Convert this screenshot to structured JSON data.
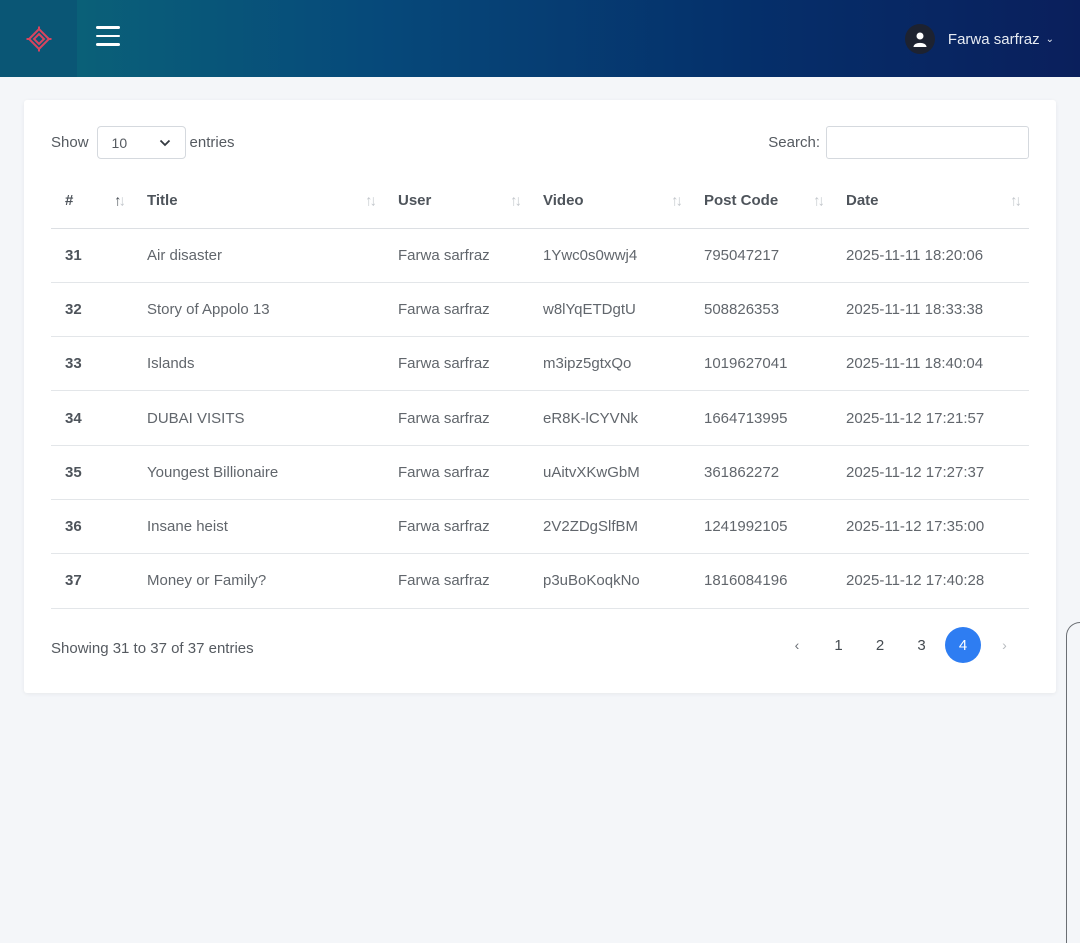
{
  "header": {
    "logo_icon": "diamond-gear-logo",
    "menu_icon": "hamburger-icon",
    "user_icon": "user-icon",
    "user_name": "Farwa sarfraz",
    "brand_colors": {
      "gradient_start": "#0b6678",
      "gradient_end": "#0a1f5c",
      "logo": "#d9445f"
    }
  },
  "controls": {
    "show_label": "Show",
    "entries_label": "entries",
    "page_length": "10",
    "search_label": "Search:",
    "search_value": ""
  },
  "table": {
    "columns": [
      "#",
      "Title",
      "User",
      "Video",
      "Post Code",
      "Date"
    ],
    "rows": [
      {
        "num": "31",
        "title": "Air disaster",
        "user": "Farwa sarfraz",
        "video": "1Ywc0s0wwj4",
        "post_code": "795047217",
        "date": "2025-11-11 18:20:06"
      },
      {
        "num": "32",
        "title": "Story of Appolo 13",
        "user": "Farwa sarfraz",
        "video": "w8lYqETDgtU",
        "post_code": "508826353",
        "date": "2025-11-11 18:33:38"
      },
      {
        "num": "33",
        "title": "Islands",
        "user": "Farwa sarfraz",
        "video": "m3ipz5gtxQo",
        "post_code": "1019627041",
        "date": "2025-11-11 18:40:04"
      },
      {
        "num": "34",
        "title": "DUBAI VISITS",
        "user": "Farwa sarfraz",
        "video": "eR8K-lCYVNk",
        "post_code": "1664713995",
        "date": "2025-11-12 17:21:57"
      },
      {
        "num": "35",
        "title": "Youngest Billionaire",
        "user": "Farwa sarfraz",
        "video": "uAitvXKwGbM",
        "post_code": "361862272",
        "date": "2025-11-12 17:27:37"
      },
      {
        "num": "36",
        "title": "Insane heist",
        "user": "Farwa sarfraz",
        "video": "2V2ZDgSlfBM",
        "post_code": "1241992105",
        "date": "2025-11-12 17:35:00"
      },
      {
        "num": "37",
        "title": "Money or Family?",
        "user": "Farwa sarfraz",
        "video": "p3uBoKoqkNo",
        "post_code": "1816084196",
        "date": "2025-11-12 17:40:28"
      }
    ]
  },
  "footer": {
    "info": "Showing 31 to 37 of 37 entries",
    "prev": "‹",
    "next": "›",
    "pages": [
      "1",
      "2",
      "3",
      "4"
    ],
    "active_page": "4",
    "active_color": "#2e7df2"
  }
}
